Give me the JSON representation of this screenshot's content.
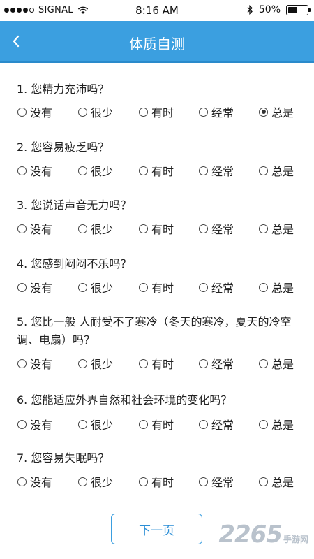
{
  "status": {
    "carrier": "SIGNAL",
    "time": "8:16 AM",
    "battery": "50%",
    "battery_level": 0.5
  },
  "nav": {
    "title": "体质自测"
  },
  "options": [
    "没有",
    "很少",
    "有时",
    "经常",
    "总是"
  ],
  "questions": [
    {
      "text": "1. 您精力充沛吗？",
      "selected": 4
    },
    {
      "text": "2. 您容易疲乏吗？",
      "selected": null
    },
    {
      "text": "3. 您说话声音无力吗？",
      "selected": null
    },
    {
      "text": "4. 您感到闷闷不乐吗？",
      "selected": null
    },
    {
      "text": "5. 您比一般 人耐受不了寒冷（冬天的寒冷，夏天的冷空调、电扇）吗？",
      "selected": null
    },
    {
      "text": "6. 您能适应外界自然和社会环境的变化吗？",
      "selected": null
    },
    {
      "text": "7. 您容易失眠吗？",
      "selected": null
    }
  ],
  "next_label": "下一页",
  "watermark": {
    "number": "2265",
    "text": "手游网"
  }
}
